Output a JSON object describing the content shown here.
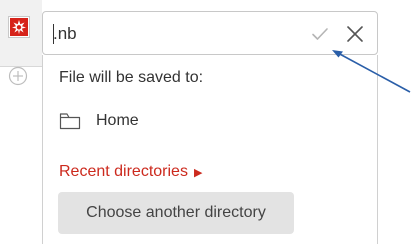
{
  "filename_field": {
    "value": ".nb"
  },
  "save_location": {
    "label": "File will be saved to:",
    "folder": "Home"
  },
  "recent_directories": {
    "label": "Recent directories"
  },
  "choose_directory": {
    "label": "Choose another directory"
  },
  "icons": {
    "app": "spiky-red-app-icon",
    "add": "add-circle-icon",
    "confirm": "check-icon",
    "close": "close-icon",
    "folder": "folder-icon",
    "expand": "triangle-right-icon"
  },
  "colors": {
    "accent": "#cc2a1e",
    "annotation": "#2a5ea8",
    "button_bg": "#e3e3e3"
  }
}
